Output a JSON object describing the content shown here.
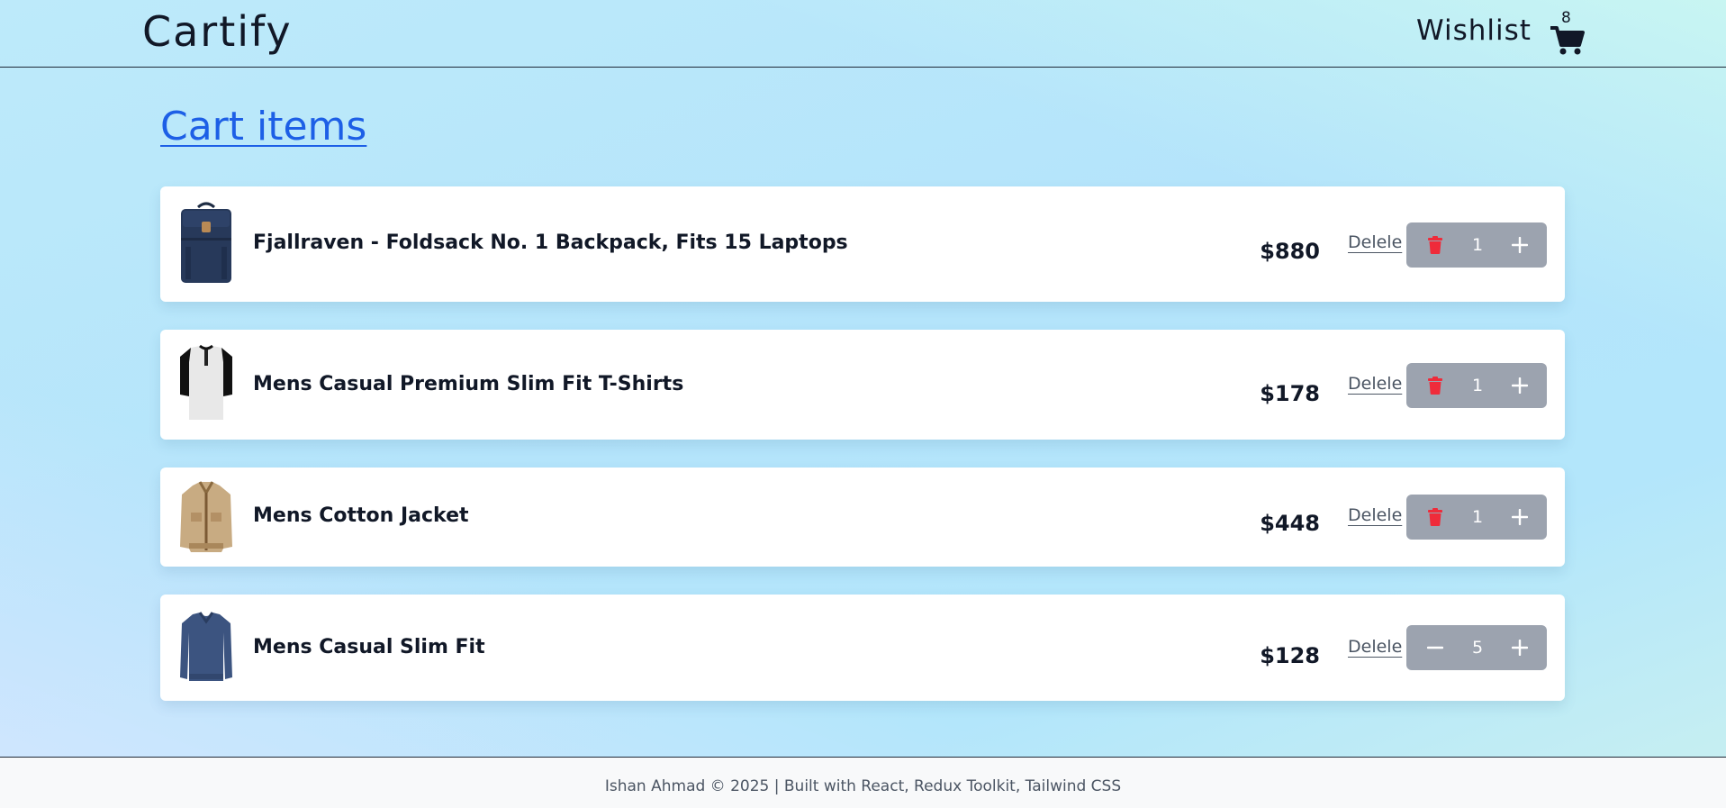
{
  "navbar": {
    "brand": "Cartify",
    "wishlist_label": "Wishlist",
    "cart_count": "8",
    "cart_icon": "shopping-cart-icon"
  },
  "page": {
    "title": "Cart items"
  },
  "cart": {
    "items": [
      {
        "name": "Fjallraven - Foldsack No. 1 Backpack, Fits 15 Laptops",
        "price": "$880",
        "delete_label": "Delele",
        "quantity": "1",
        "decrement_icon": "trash-icon",
        "increment_icon": "plus-icon",
        "thumbnail": "backpack-thumbnail"
      },
      {
        "name": "Mens Casual Premium Slim Fit T-Shirts",
        "price": "$178",
        "delete_label": "Delele",
        "quantity": "1",
        "decrement_icon": "trash-icon",
        "increment_icon": "plus-icon",
        "thumbnail": "tshirt-thumbnail"
      },
      {
        "name": "Mens Cotton Jacket",
        "price": "$448",
        "delete_label": "Delele",
        "quantity": "1",
        "decrement_icon": "trash-icon",
        "increment_icon": "plus-icon",
        "thumbnail": "jacket-thumbnail"
      },
      {
        "name": "Mens Casual Slim Fit",
        "price": "$128",
        "delete_label": "Delele",
        "quantity": "5",
        "decrement_icon": "minus-icon",
        "increment_icon": "plus-icon",
        "thumbnail": "slimfit-shirt-thumbnail"
      }
    ]
  },
  "footer": {
    "text": "Ishan Ahmad © 2025 | Built with React, Redux Toolkit, Tailwind CSS"
  },
  "colors": {
    "title_link": "#1d5fe6",
    "trash_icon": "#ef2b3a",
    "stepper_bg": "#9ca3af"
  }
}
